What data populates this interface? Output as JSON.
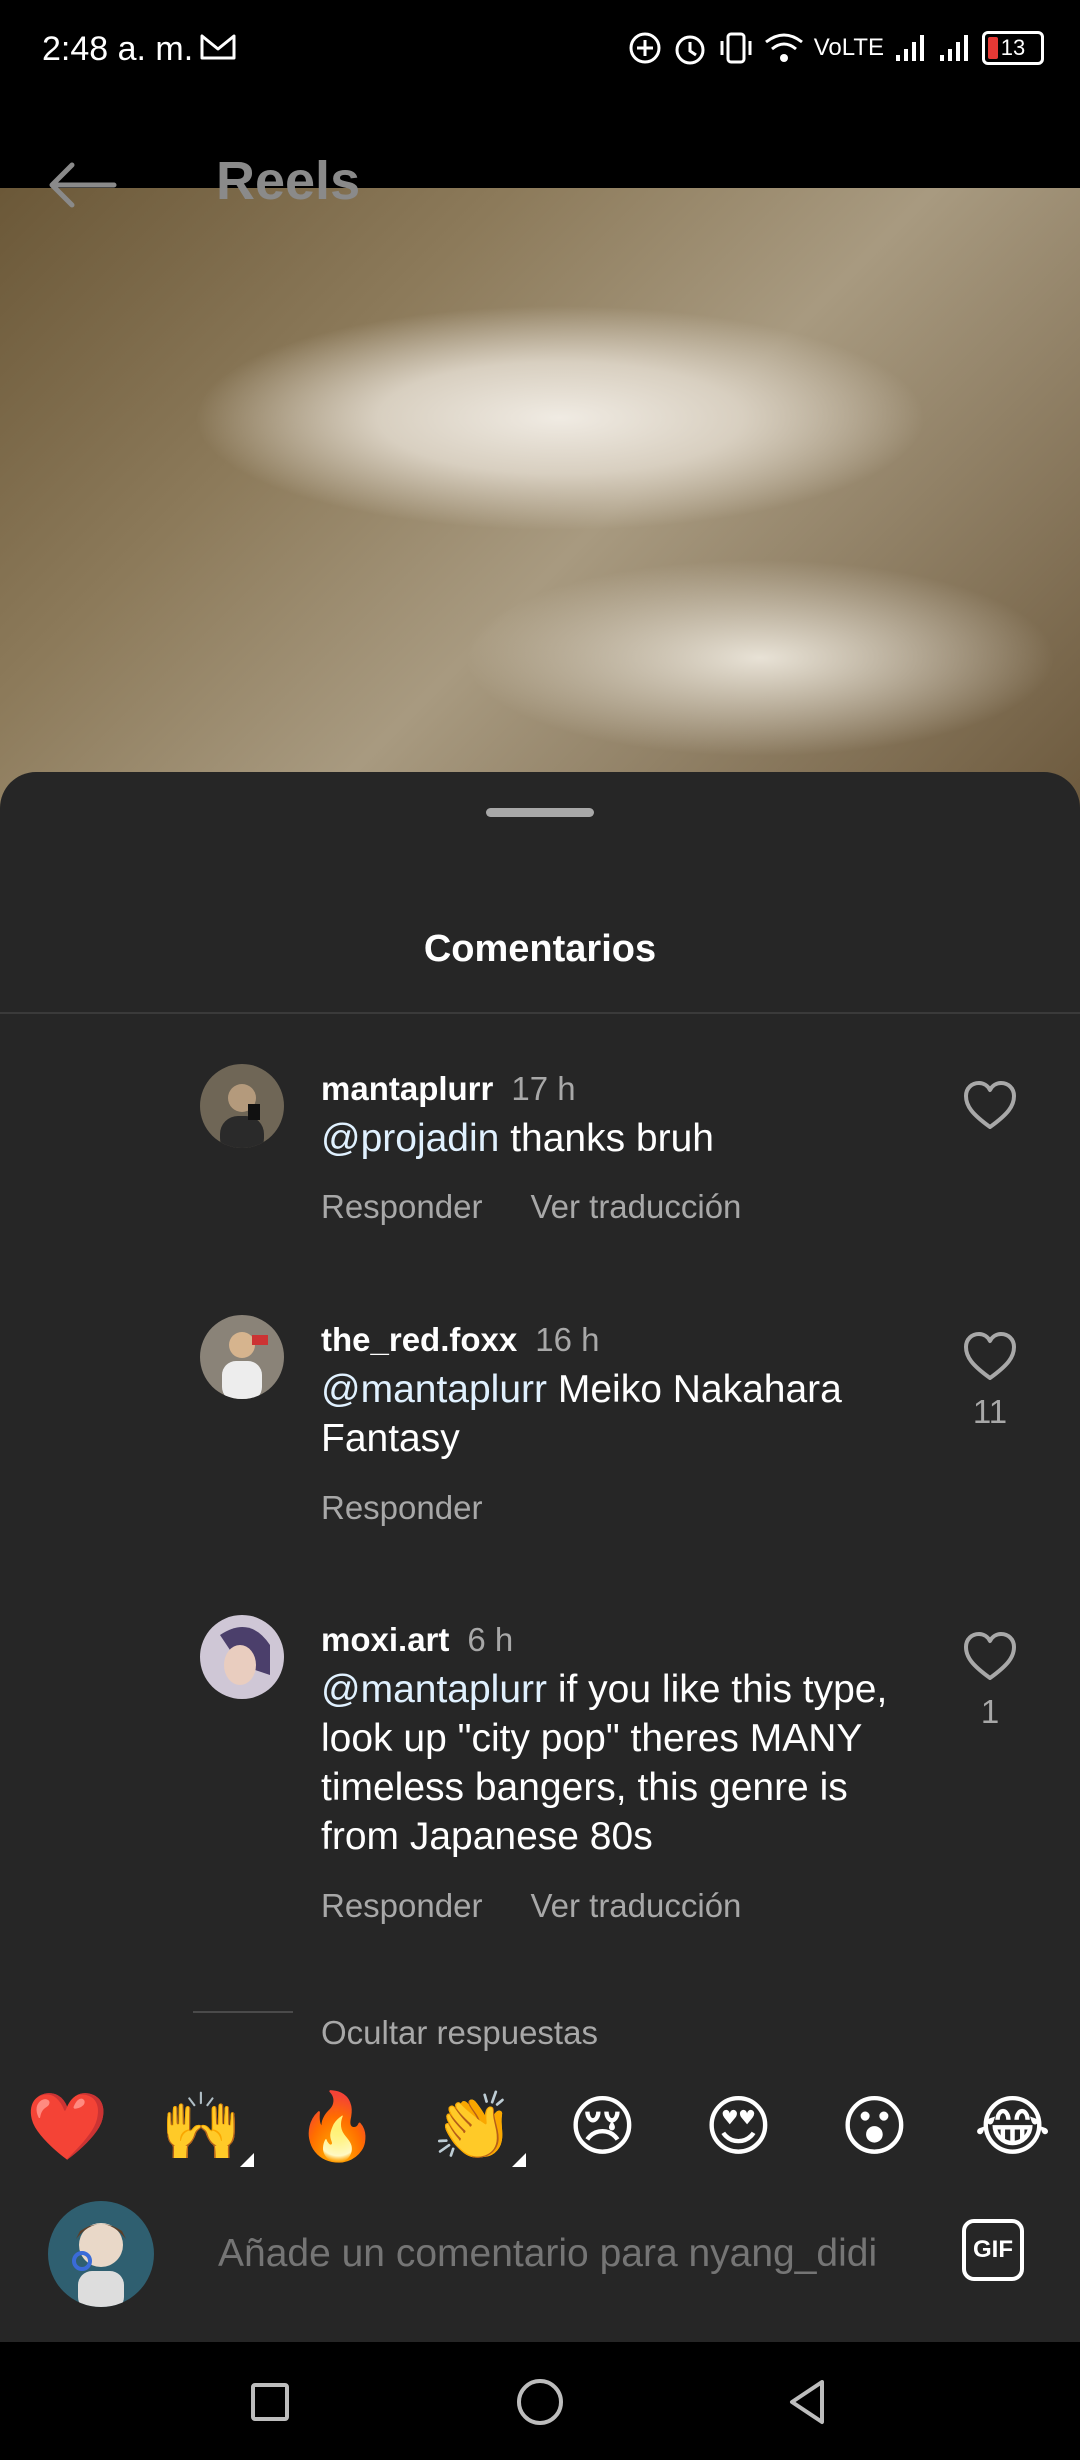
{
  "status_bar": {
    "time": "2:48 a. m.",
    "network": "VoLTE",
    "battery": "13",
    "icons": [
      "gmail-icon",
      "add-circle-icon",
      "alarm-icon",
      "vibrate-icon",
      "wifi-icon",
      "signal-icon",
      "signal-icon",
      "battery-icon"
    ]
  },
  "header": {
    "title": "Reels",
    "back_icon": "arrow-left-icon"
  },
  "comments_sheet": {
    "title": "Comentarios",
    "comments": [
      {
        "user": "mantaplurr",
        "time": "17 h",
        "mention": "@projadin",
        "text": " thanks bruh",
        "actions": [
          "Responder",
          "Ver traducción"
        ],
        "likes": ""
      },
      {
        "user": "the_red.foxx",
        "time": "16 h",
        "mention": "@mantaplurr",
        "text": " Meiko Nakahara Fantasy",
        "actions": [
          "Responder"
        ],
        "likes": "11"
      },
      {
        "user": "moxi.art",
        "time": "6 h",
        "mention": "@mantaplurr",
        "text": " if you like this type, look up \"city pop\" theres MANY timeless bangers, this genre is from Japanese 80s",
        "actions": [
          "Responder",
          "Ver traducción"
        ],
        "likes": "1"
      }
    ],
    "hide_replies": "Ocultar respuestas"
  },
  "emoji_bar": [
    "❤️",
    "🙌",
    "🔥",
    "👏",
    "😢",
    "😍",
    "😮",
    "😂"
  ],
  "input": {
    "placeholder": "Añade un comentario para nyang_didi",
    "gif_label": "GIF"
  },
  "colors": {
    "sheet_bg": "#262626",
    "secondary_text": "#a8a8a8",
    "mention": "#e0f1ff",
    "battery_low": "#e53935"
  }
}
